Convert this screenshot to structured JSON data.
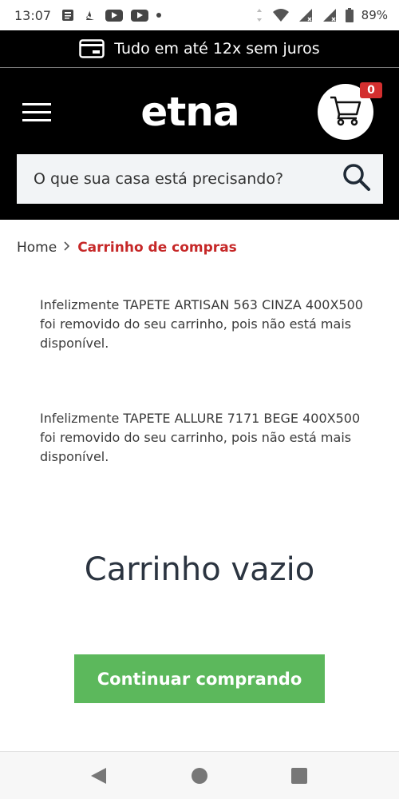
{
  "status_bar": {
    "time": "13:07",
    "battery": "89%",
    "icons": [
      "news-icon",
      "santander-icon",
      "youtube-icon",
      "youtube-icon",
      "dot-icon",
      "vibrate-icon",
      "wifi-icon",
      "signal-icon",
      "signal-icon",
      "battery-icon"
    ]
  },
  "promo": {
    "text": "Tudo em até 12x sem juros",
    "icon": "credit-card-icon"
  },
  "header": {
    "logo_text": "etna",
    "cart_count": "0",
    "search_placeholder": "O que sua casa está precisando?"
  },
  "breadcrumb": {
    "home": "Home",
    "separator": ">",
    "current": "Carrinho de compras"
  },
  "messages": [
    "Infelizmente TAPETE ARTISAN 563 CINZA 400X500 foi removido do seu carrinho, pois não está mais disponível.",
    "Infelizmente TAPETE ALLURE 7171 BEGE 400X500 foi removido do seu carrinho, pois não está mais disponível."
  ],
  "empty_cart": {
    "title": "Carrinho vazio",
    "continue_label": "Continuar comprando"
  },
  "colors": {
    "header_bg": "#000000",
    "accent_red": "#c62828",
    "button_green": "#5cb85c",
    "badge_red": "#d32f2f"
  }
}
